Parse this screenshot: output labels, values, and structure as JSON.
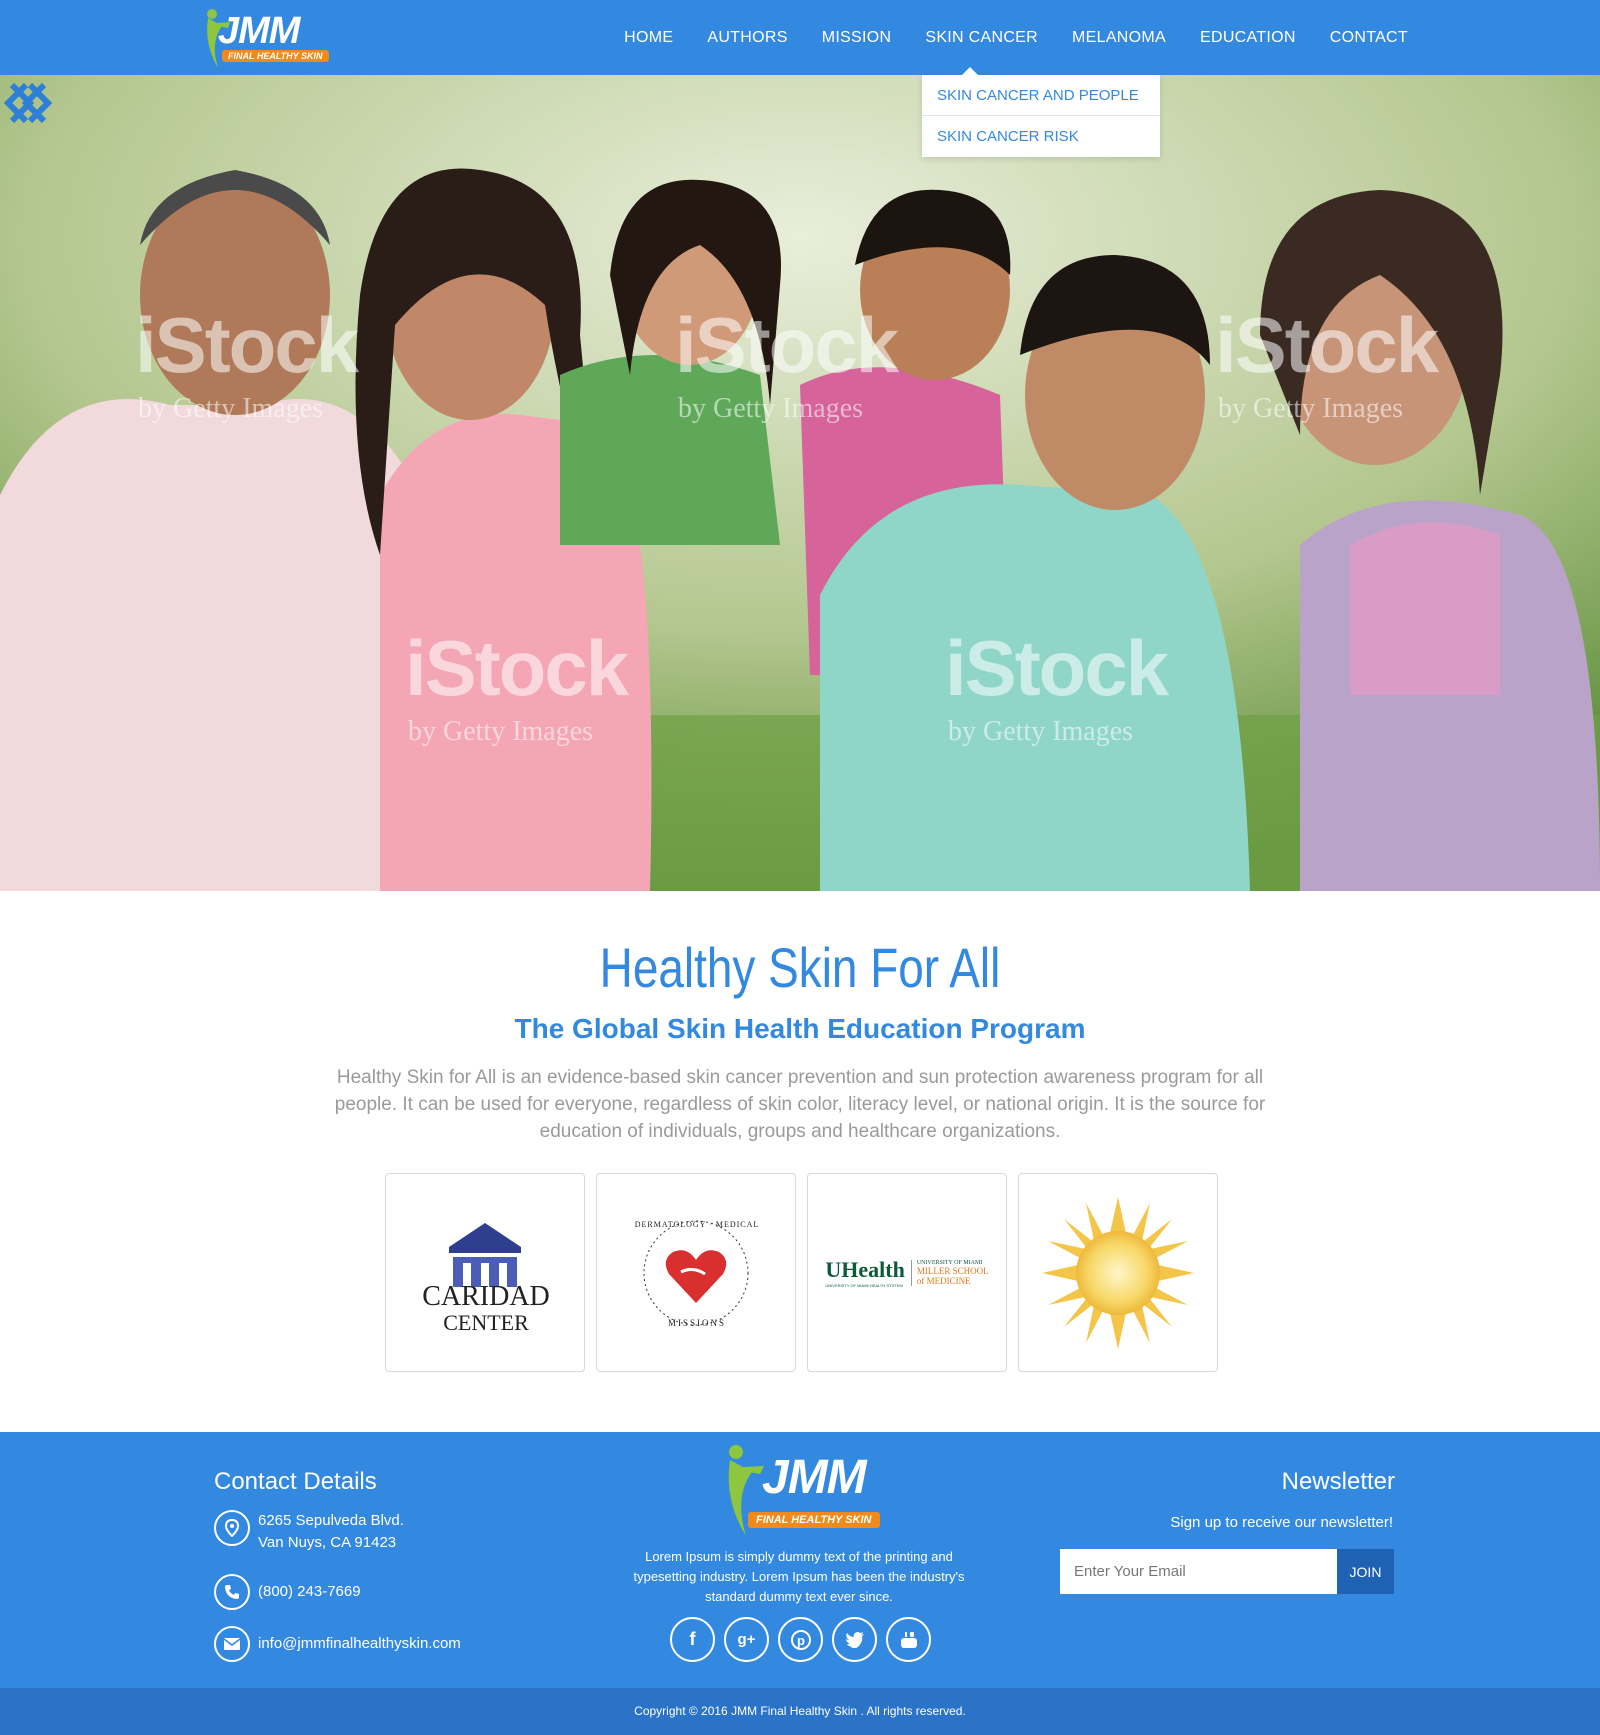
{
  "brand": {
    "logo_text": "JMM",
    "logo_tagline": "FINAL HEALTHY SKIN",
    "accent_color": "#3389e0",
    "orange": "#f08a1c"
  },
  "nav": {
    "items": [
      "HOME",
      "AUTHORS",
      "MISSION",
      "SKIN CANCER",
      "MELANOMA",
      "EDUCATION",
      "CONTACT"
    ],
    "dropdown": [
      "SKIN CANCER AND PEOPLE",
      "SKIN CANCER RISK"
    ]
  },
  "hero": {
    "watermark": "iStock",
    "watermark_sub": "by Getty Images",
    "prev_icon": "double-chevron-left-icon",
    "next_icon": "double-chevron-right-icon"
  },
  "intro": {
    "title": "Healthy Skin For All",
    "subtitle": "The Global Skin Health Education Program",
    "text": "Healthy Skin for All is an evidence-based skin cancer prevention and sun protection awareness program for all people. It can be used for everyone, regardless of skin color, literacy level, or national origin. It is the source for education of individuals, groups and healthcare organizations."
  },
  "partners": [
    {
      "name": "CARIDAD CENTER",
      "line1": "CARIDAD",
      "line2": "CENTER"
    },
    {
      "name": "DERMATOLOGY MEDICAL MISSIONS",
      "top": "DERMATOLOGY · MEDICAL",
      "bottom": "MISSIONS"
    },
    {
      "name": "UHealth Miller School of Medicine",
      "mark": "UHealth",
      "sub": "UNIVERSITY OF MIAMI HEALTH SYSTEM",
      "right1": "UNIVERSITY OF MIAMI",
      "right2": "MILLER SCHOOL",
      "right3": "of MEDICINE"
    },
    {
      "name": "sun"
    }
  ],
  "footer": {
    "contact_title": "Contact Details",
    "address_line1": "6265 Sepulveda Blvd.",
    "address_line2": "Van Nuys, CA 91423",
    "phone": "(800) 243-7669",
    "email": "info@jmmfinalhealthyskin.com",
    "about_text": "Lorem Ipsum is simply dummy text of the printing and typesetting industry. Lorem Ipsum has been the industry's standard dummy text ever since.",
    "socials": [
      "facebook-icon",
      "google-plus-icon",
      "pinterest-icon",
      "twitter-icon",
      "youtube-icon"
    ],
    "newsletter_title": "Newsletter",
    "newsletter_sub": "Sign up to receive our newsletter!",
    "email_placeholder": "Enter Your Email",
    "join_label": "JOIN"
  },
  "copyright": "Copyright © 2016 JMM Final Healthy Skin . All rights reserved."
}
